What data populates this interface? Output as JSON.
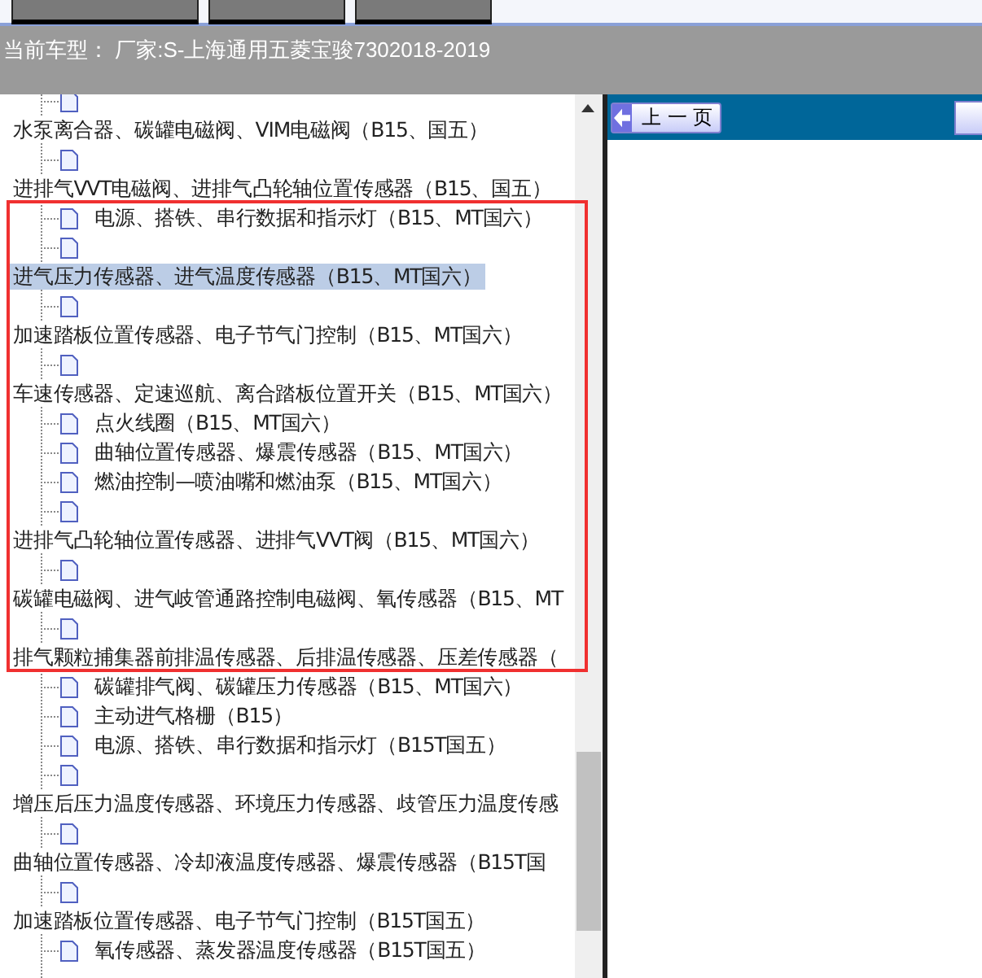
{
  "vehicle_bar": {
    "text": "当前车型： 厂家:S-上海通用五菱宝骏7302018-2019"
  },
  "tree": {
    "items": [
      {
        "kind": "wrapped",
        "label": "水泵离合器、碳罐电磁阀、VIM电磁阀（B15、国五）",
        "selected": false
      },
      {
        "kind": "wrapped",
        "label": "进排气VVT电磁阀、进排气凸轮轴位置传感器（B15、国五）",
        "selected": false
      },
      {
        "kind": "inline",
        "label": "电源、搭铁、串行数据和指示灯（B15、MT国六）",
        "selected": false
      },
      {
        "kind": "wrapped",
        "label": "进气压力传感器、进气温度传感器（B15、MT国六）",
        "selected": true
      },
      {
        "kind": "wrapped",
        "label": "加速踏板位置传感器、电子节气门控制（B15、MT国六）",
        "selected": false
      },
      {
        "kind": "wrapped",
        "label": "车速传感器、定速巡航、离合踏板位置开关（B15、MT国六）",
        "selected": false
      },
      {
        "kind": "inline",
        "label": "点火线圈（B15、MT国六）",
        "selected": false
      },
      {
        "kind": "inline",
        "label": "曲轴位置传感器、爆震传感器（B15、MT国六）",
        "selected": false
      },
      {
        "kind": "inline",
        "label": "燃油控制—喷油嘴和燃油泵（B15、MT国六）",
        "selected": false
      },
      {
        "kind": "wrapped",
        "label": "进排气凸轮轴位置传感器、进排气VVT阀（B15、MT国六）",
        "selected": false
      },
      {
        "kind": "wrapped",
        "label": "碳罐电磁阀、进气岐管通路控制电磁阀、氧传感器（B15、MT",
        "selected": false
      },
      {
        "kind": "wrapped",
        "label": "排气颗粒捕集器前排温传感器、后排温传感器、压差传感器（",
        "selected": false
      },
      {
        "kind": "inline",
        "label": "碳罐排气阀、碳罐压力传感器（B15、MT国六）",
        "selected": false
      },
      {
        "kind": "inline",
        "label": "主动进气格栅（B15）",
        "selected": false
      },
      {
        "kind": "inline",
        "label": "电源、搭铁、串行数据和指示灯（B15T国五）",
        "selected": false
      },
      {
        "kind": "wrapped",
        "label": "增压后压力温度传感器、环境压力传感器、歧管压力温度传感",
        "selected": false
      },
      {
        "kind": "wrapped",
        "label": "曲轴位置传感器、冷却液温度传感器、爆震传感器（B15T国",
        "selected": false
      },
      {
        "kind": "wrapped",
        "label": "加速踏板位置传感器、电子节气门控制（B15T国五）",
        "selected": false
      },
      {
        "kind": "inline",
        "label": "氧传感器、蒸发器温度传感器（B15T国五）",
        "selected": false
      }
    ]
  },
  "viewer": {
    "prev_button": "上 一 页"
  }
}
